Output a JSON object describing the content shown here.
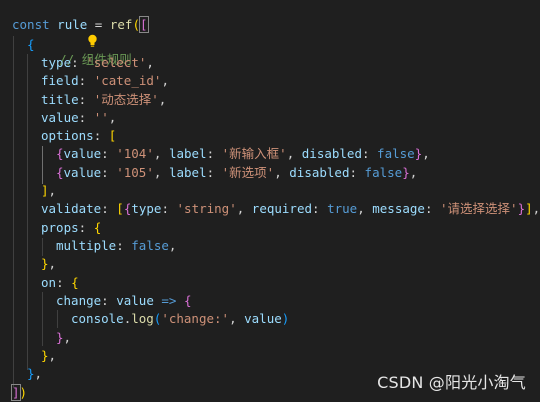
{
  "comment": "组件规则",
  "icons": {
    "hint": "lightbulb-icon"
  },
  "code": {
    "l1_kw": "const",
    "l1_name": "rule",
    "l1_eq": " = ",
    "l1_fn": "ref",
    "l1_open": "(",
    "l1_bracket": "[",
    "brace_open": "{",
    "type_key": "type",
    "type_val": "'select'",
    "field_key": "field",
    "field_val": "'cate_id'",
    "title_key": "title",
    "title_val": "'动态选择'",
    "value_key": "value",
    "value_val": "''",
    "options_key": "options",
    "bracket_open": "[",
    "opt1_value": "'104'",
    "opt1_label": "'新输入框'",
    "opt2_value": "'105'",
    "opt2_label": "'新选项'",
    "disabled_key": "disabled",
    "false_kw": "false",
    "true_kw": "true",
    "value_prop": "value",
    "label_prop": "label",
    "validate_key": "validate",
    "validate_type_key": "type",
    "validate_type_val": "'string'",
    "required_key": "required",
    "message_key": "message",
    "message_val": "'请选择选择'",
    "props_key": "props",
    "multiple_key": "multiple",
    "on_key": "on",
    "change_key": "change",
    "arrow_param": "value",
    "arrow": "=>",
    "console_obj": "console",
    "log_fn": "log",
    "log_str": "'change:'",
    "log_arg": "value"
  },
  "watermark": "CSDN @阳光小淘气"
}
